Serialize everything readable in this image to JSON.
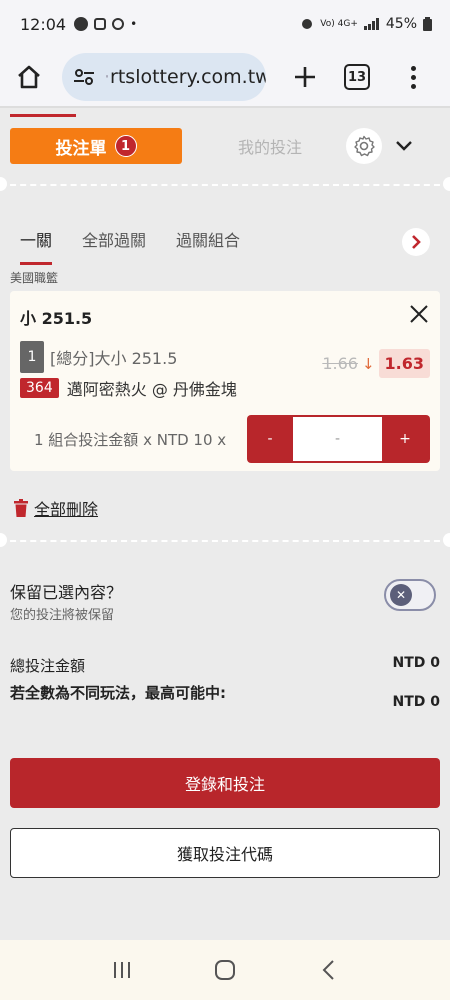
{
  "status_bar": {
    "time": "12:04",
    "notif_icons": [
      "line-app-icon",
      "chat-icon",
      "location-icon",
      "dot-icon"
    ],
    "signal_text": "Vo) 4G+",
    "battery": "45%"
  },
  "browser": {
    "url_prefix": "·",
    "url_text": "rtslottery.com.tw",
    "tab_count": "13"
  },
  "betslip": {
    "tab_bet": "投注單",
    "tab_bet_count": "1",
    "tab_mine": "我的投注"
  },
  "sub_tabs": [
    "一關",
    "全部過關",
    "過關組合"
  ],
  "league": "美國職籃",
  "selection": {
    "title": "小 251.5",
    "leg_number": "1",
    "market": "[總分]大小 251.5",
    "old_odds": "1.66",
    "new_odds": "1.63",
    "event_id": "364",
    "match": "邁阿密熱火 @ 丹佛金塊",
    "stake_label": "1 組合投注金額 x NTD 10 x",
    "minus": "-",
    "stake_value": "-",
    "plus": "+"
  },
  "delete_all": "全部刪除",
  "keep": {
    "title": "保留已選內容？",
    "subtitle": "您的投注將被保留",
    "toggle_on": false
  },
  "totals": {
    "total_label": "總投注金額",
    "total_value": "NTD 0",
    "max_label": "若全數為不同玩法，最高可能中:",
    "max_value": "NTD 0"
  },
  "buttons": {
    "login_bet": "登錄和投注",
    "get_code": "獲取投注代碼"
  },
  "colors": {
    "accent_orange": "#f57c14",
    "brand_red": "#b8262b"
  }
}
